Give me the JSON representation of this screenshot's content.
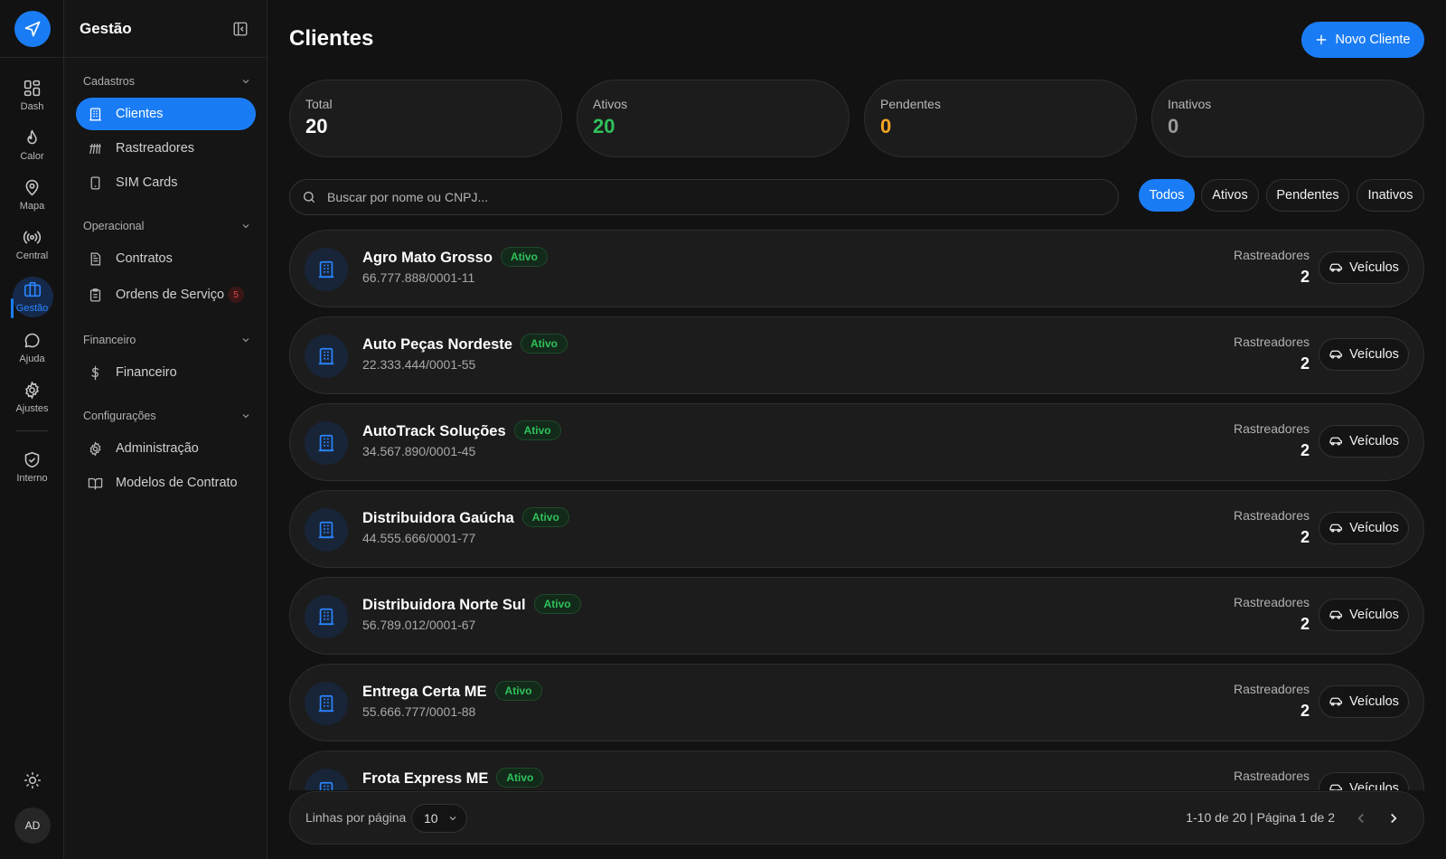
{
  "rail": {
    "items": [
      {
        "label": "Dash",
        "icon": "dashboard-icon"
      },
      {
        "label": "Calor",
        "icon": "flame-icon"
      },
      {
        "label": "Mapa",
        "icon": "map-pin-icon"
      },
      {
        "label": "Central",
        "icon": "broadcast-icon"
      },
      {
        "label": "Gestão",
        "icon": "briefcase-icon",
        "active": true
      },
      {
        "label": "Ajuda",
        "icon": "chat-bubble-icon"
      },
      {
        "label": "Ajustes",
        "icon": "gear-icon"
      },
      {
        "label": "Interno",
        "icon": "shield-check-icon"
      }
    ],
    "avatar": "AD"
  },
  "sidebar": {
    "title": "Gestão",
    "sections": [
      {
        "title": "Cadastros",
        "items": [
          {
            "label": "Clientes",
            "active": true
          },
          {
            "label": "Rastreadores"
          },
          {
            "label": "SIM Cards"
          }
        ]
      },
      {
        "title": "Operacional",
        "items": [
          {
            "label": "Contratos"
          },
          {
            "label": "Ordens de Serviço",
            "badge": "5"
          }
        ]
      },
      {
        "title": "Financeiro",
        "items": [
          {
            "label": "Financeiro"
          }
        ]
      },
      {
        "title": "Configurações",
        "items": [
          {
            "label": "Administração"
          },
          {
            "label": "Modelos de Contrato"
          }
        ]
      }
    ]
  },
  "header": {
    "title": "Clientes",
    "new_button": "Novo Cliente"
  },
  "stats": [
    {
      "label": "Total",
      "value": "20",
      "color": "#ffffff"
    },
    {
      "label": "Ativos",
      "value": "20",
      "color": "#2fc15b"
    },
    {
      "label": "Pendentes",
      "value": "0",
      "color": "#f5a524"
    },
    {
      "label": "Inativos",
      "value": "0",
      "color": "#9a9a9a"
    }
  ],
  "search": {
    "placeholder": "Buscar por nome ou CNPJ...",
    "value": ""
  },
  "filters": [
    {
      "label": "Todos",
      "active": true
    },
    {
      "label": "Ativos"
    },
    {
      "label": "Pendentes"
    },
    {
      "label": "Inativos"
    }
  ],
  "clients": [
    {
      "name": "Agro Mato Grosso",
      "status": "Ativo",
      "cnpj": "66.777.888/0001-11",
      "trackers_label": "Rastreadores",
      "trackers": "2",
      "action": "Veículos"
    },
    {
      "name": "Auto Peças Nordeste",
      "status": "Ativo",
      "cnpj": "22.333.444/0001-55",
      "trackers_label": "Rastreadores",
      "trackers": "2",
      "action": "Veículos"
    },
    {
      "name": "AutoTrack Soluções",
      "status": "Ativo",
      "cnpj": "34.567.890/0001-45",
      "trackers_label": "Rastreadores",
      "trackers": "2",
      "action": "Veículos"
    },
    {
      "name": "Distribuidora Gaúcha",
      "status": "Ativo",
      "cnpj": "44.555.666/0001-77",
      "trackers_label": "Rastreadores",
      "trackers": "2",
      "action": "Veículos"
    },
    {
      "name": "Distribuidora Norte Sul",
      "status": "Ativo",
      "cnpj": "56.789.012/0001-67",
      "trackers_label": "Rastreadores",
      "trackers": "2",
      "action": "Veículos"
    },
    {
      "name": "Entrega Certa ME",
      "status": "Ativo",
      "cnpj": "55.666.777/0001-88",
      "trackers_label": "Rastreadores",
      "trackers": "2",
      "action": "Veículos"
    },
    {
      "name": "Frota Express ME",
      "status": "Ativo",
      "cnpj": "",
      "trackers_label": "Rastreadores",
      "trackers": "",
      "action": "Veículos"
    }
  ],
  "pagination": {
    "rows_label": "Linhas por página",
    "rows_value": "10",
    "range": "1-10 de 20 | Página 1 de 2"
  },
  "colors": {
    "accent": "#1a7cf5",
    "success": "#2fc15b",
    "warning": "#f5a524",
    "danger": "#e04a4a"
  }
}
